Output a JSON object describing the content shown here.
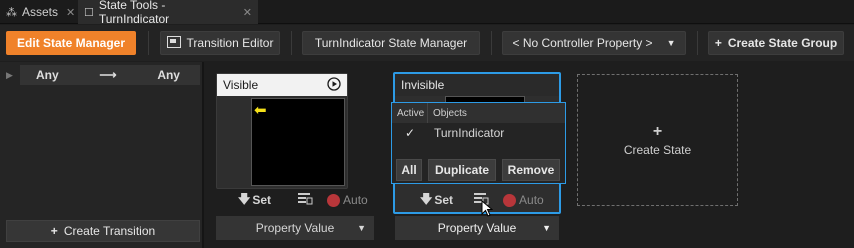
{
  "tabs": [
    {
      "label": "Assets",
      "icon": "assets-icon",
      "close": "✕"
    },
    {
      "label": "State Tools - TurnIndicator",
      "icon": "state-tools-icon",
      "close": "✕"
    }
  ],
  "toolbar": {
    "edit_state_manager": "Edit State Manager",
    "transition_editor": "Transition Editor",
    "state_manager_name": "TurnIndicator State Manager",
    "controller_property": "< No Controller Property >",
    "create_state_group": "Create State Group"
  },
  "left_panel": {
    "transition_from": "Any",
    "transition_to": "Any",
    "arrow": "⟶",
    "create_transition": "Create Transition"
  },
  "states": [
    {
      "name": "Visible",
      "set_label": "Set",
      "auto_label": "Auto",
      "property_value": "Property Value"
    },
    {
      "name": "Invisible",
      "set_label": "Set",
      "auto_label": "Auto",
      "property_value": "Property Value"
    }
  ],
  "create_state": {
    "plus": "+",
    "label": "Create State"
  },
  "popup": {
    "col_active": "Active",
    "col_objects": "Objects",
    "rows": [
      {
        "checked": "✓",
        "object": "TurnIndicator"
      }
    ],
    "all_label": "All",
    "duplicate_label": "Duplicate",
    "remove_label": "Remove"
  },
  "colors": {
    "accent": "#2d9be6",
    "primary_button": "#f0822a",
    "auto_record": "#b8363a",
    "arrow_mark": "#f5e11a"
  }
}
